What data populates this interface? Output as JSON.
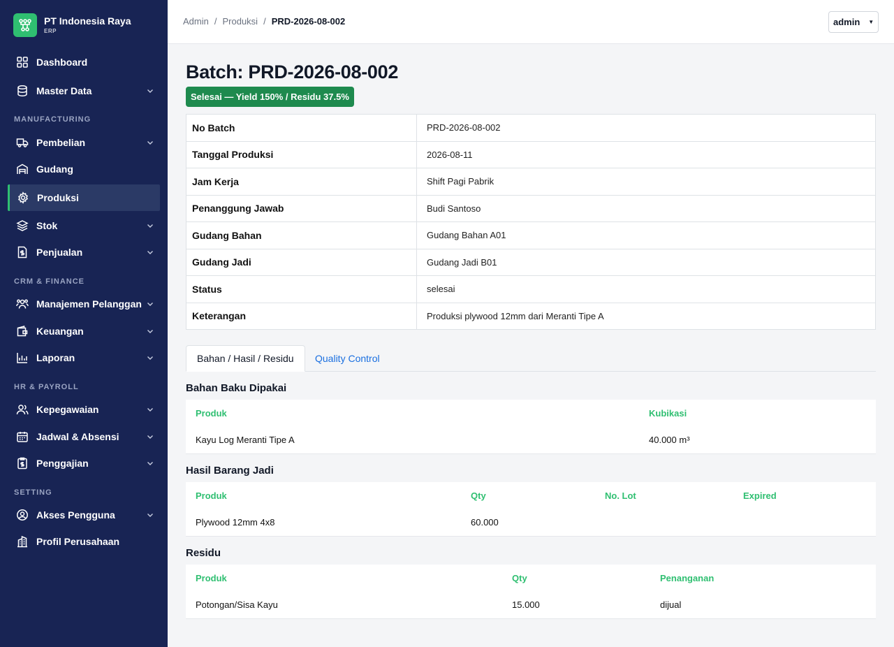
{
  "brand": {
    "name": "PT Indonesia Raya",
    "sub": "ERP"
  },
  "sidebar": {
    "dashboard": "Dashboard",
    "master_data": "Master Data",
    "sec_manufacturing": "MANUFACTURING",
    "pembelian": "Pembelian",
    "gudang": "Gudang",
    "produksi": "Produksi",
    "stok": "Stok",
    "penjualan": "Penjualan",
    "sec_crm": "CRM & FINANCE",
    "manajemen_pelanggan": "Manajemen Pelanggan",
    "keuangan": "Keuangan",
    "laporan": "Laporan",
    "sec_hr": "HR & PAYROLL",
    "kepegawaian": "Kepegawaian",
    "jadwal_absensi": "Jadwal & Absensi",
    "penggajian": "Penggajian",
    "sec_setting": "SETTING",
    "akses_pengguna": "Akses Pengguna",
    "profil_perusahaan": "Profil Perusahaan"
  },
  "breadcrumb": {
    "c1": "Admin",
    "c2": "Produksi",
    "current": "PRD-2026-08-002",
    "sep": "/"
  },
  "user": {
    "name": "admin"
  },
  "page": {
    "title": "Batch: PRD-2026-08-002",
    "badge": "Selesai — Yield 150% / Residu 37.5%"
  },
  "info": {
    "no_batch": {
      "label": "No Batch",
      "value": "PRD-2026-08-002"
    },
    "tanggal": {
      "label": "Tanggal Produksi",
      "value": "2026-08-11"
    },
    "jam_kerja": {
      "label": "Jam Kerja",
      "value": "Shift Pagi Pabrik"
    },
    "pj": {
      "label": "Penanggung Jawab",
      "value": "Budi Santoso"
    },
    "gudang_bahan": {
      "label": "Gudang Bahan",
      "value": "Gudang Bahan A01"
    },
    "gudang_jadi": {
      "label": "Gudang Jadi",
      "value": "Gudang Jadi B01"
    },
    "status": {
      "label": "Status",
      "value": "selesai"
    },
    "keterangan": {
      "label": "Keterangan",
      "value": "Produksi plywood 12mm dari Meranti Tipe A"
    }
  },
  "tabs": {
    "t1": "Bahan / Hasil / Residu",
    "t2": "Quality Control"
  },
  "bahan": {
    "title": "Bahan Baku Dipakai",
    "h_produk": "Produk",
    "h_kubikasi": "Kubikasi",
    "row": {
      "produk": "Kayu Log Meranti Tipe A",
      "kubikasi": "40.000 m³"
    }
  },
  "hasil": {
    "title": "Hasil Barang Jadi",
    "h_produk": "Produk",
    "h_qty": "Qty",
    "h_lot": "No. Lot",
    "h_expired": "Expired",
    "row": {
      "produk": "Plywood 12mm 4x8",
      "qty": "60.000",
      "lot": "",
      "expired": ""
    }
  },
  "residu": {
    "title": "Residu",
    "h_produk": "Produk",
    "h_qty": "Qty",
    "h_penanganan": "Penanganan",
    "row": {
      "produk": "Potongan/Sisa Kayu",
      "qty": "15.000",
      "penanganan": "dijual"
    }
  },
  "colors": {
    "sidebar": "#182454",
    "accent": "#2fbf71",
    "badge": "#1e8a4e",
    "link": "#1a6fe0"
  }
}
